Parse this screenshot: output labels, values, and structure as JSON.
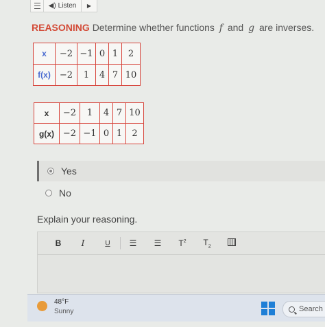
{
  "toolbar_top": {
    "listen_label": "Listen"
  },
  "question": {
    "keyword": "REASONING",
    "text_before": "Determine whether functions",
    "var_f": "f",
    "conj": "and",
    "var_g": "g",
    "text_after": "are inverses."
  },
  "table_f": {
    "header_x": "x",
    "header_y": "f(x)",
    "x": [
      "−2",
      "−1",
      "0",
      "1",
      "2"
    ],
    "y": [
      "−2",
      "1",
      "4",
      "7",
      "10"
    ]
  },
  "table_g": {
    "header_x": "x",
    "header_y": "g(x)",
    "x": [
      "−2",
      "1",
      "4",
      "7",
      "10"
    ],
    "y": [
      "−2",
      "−1",
      "0",
      "1",
      "2"
    ]
  },
  "answers": {
    "options": [
      "Yes",
      "No"
    ],
    "selected": "Yes"
  },
  "explain": {
    "prompt": "Explain your reasoning.",
    "toolbar": {
      "bold": "B",
      "italic": "I",
      "underline": "U",
      "bulleted_list": "☰",
      "numbered_list": "☰",
      "superscript": "T",
      "subscript": "T"
    }
  },
  "taskbar": {
    "temperature": "48°F",
    "condition": "Sunny",
    "search_label": "Search"
  },
  "colors": {
    "accent": "#d34a36",
    "table_border": "#d7443b",
    "windows_blue": "#1f7fd6"
  }
}
